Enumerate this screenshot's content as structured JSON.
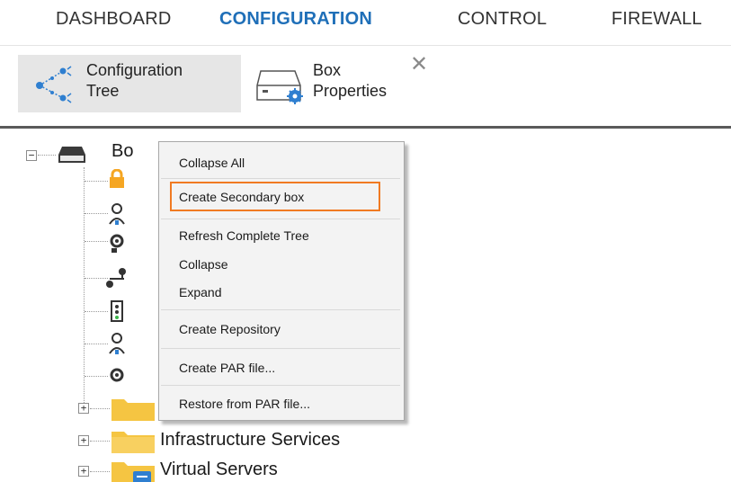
{
  "nav": {
    "tabs": [
      {
        "label": "DASHBOARD",
        "active": false
      },
      {
        "label": "CONFIGURATION",
        "active": true
      },
      {
        "label": "CONTROL",
        "active": false
      },
      {
        "label": "FIREWALL",
        "active": false
      }
    ]
  },
  "toolbar": {
    "config_tree": {
      "line1": "Configuration",
      "line2": "Tree",
      "icon": "share-nodes-icon"
    },
    "box_properties": {
      "line1": "Box",
      "line2": "Properties",
      "icon": "box-settings-icon"
    },
    "close_glyph": "✕"
  },
  "tree": {
    "root": {
      "label": "Bo",
      "expander": "−"
    },
    "folders": [
      {
        "label": "Infrastructure Services",
        "expander": "+"
      },
      {
        "label": "Virtual Servers",
        "expander": "+"
      }
    ]
  },
  "context_menu": {
    "items": [
      "Collapse All",
      "Create Secondary box",
      "Refresh Complete Tree",
      "Collapse",
      "Expand",
      "Create Repository",
      "Create PAR file...",
      "Restore from PAR file..."
    ],
    "highlighted": "Create Secondary box"
  },
  "colors": {
    "active_tab": "#1f6fb8",
    "highlight_border": "#f07a22",
    "folder_yellow": "#f5c542",
    "icon_blue": "#2f7fd0"
  }
}
